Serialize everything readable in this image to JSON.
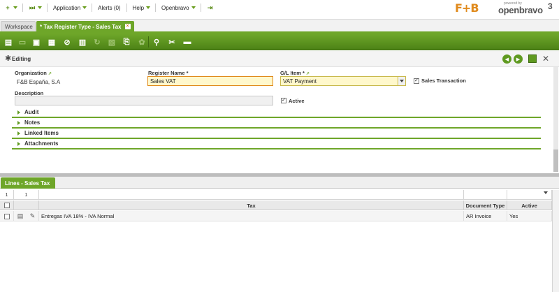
{
  "topnav": {
    "application": "Application",
    "alerts": "Alerts (0)",
    "help": "Help",
    "openbravo": "Openbravo"
  },
  "logo": {
    "brand": "F+B",
    "powered_by": "powered by",
    "product": "openbravo",
    "version": "3"
  },
  "tabs": {
    "workspace": "Workspace",
    "active": "* Tax Register Type - Sales Tax"
  },
  "colors": {
    "accent": "#6ea629",
    "required_bg": "#fff8cc",
    "logo_orange": "#e08a1c"
  },
  "form": {
    "mode": "Editing",
    "organization": {
      "label": "Organization",
      "value": "F&B España, S.A"
    },
    "register_name": {
      "label": "Register Name *",
      "value": "Sales VAT"
    },
    "gl_item": {
      "label": "G/L Item *",
      "value": "VAT Payment"
    },
    "sales_transaction": {
      "label": "Sales Transaction",
      "checked": true
    },
    "description": {
      "label": "Description",
      "value": ""
    },
    "active": {
      "label": "Active",
      "checked": true
    },
    "sections": [
      "Audit",
      "Notes",
      "Linked Items",
      "Attachments"
    ]
  },
  "lines": {
    "tab_label": "Lines - Sales Tax",
    "filter_count": "1",
    "filter_count2": "1",
    "columns": [
      "Tax",
      "Document Type",
      "Active"
    ],
    "rows": [
      {
        "tax": "Entregas IVA 18% - IVA Normal",
        "document_type": "AR Invoice",
        "active": "Yes"
      }
    ]
  }
}
